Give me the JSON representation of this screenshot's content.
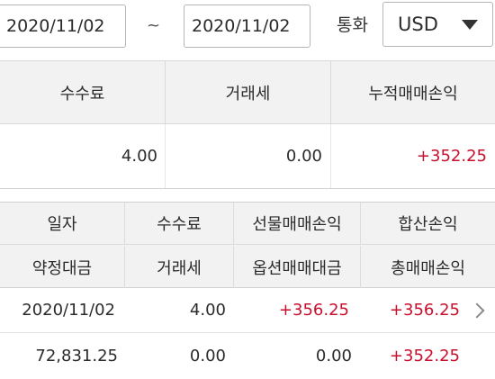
{
  "filter": {
    "date_from": "2020/11/02",
    "separator": "~",
    "date_to": "2020/11/02",
    "currency_label": "통화",
    "currency_value": "USD"
  },
  "summary": {
    "headers": [
      "수수료",
      "거래세",
      "누적매매손익"
    ],
    "values": [
      "4.00",
      "0.00",
      "+352.25"
    ]
  },
  "list": {
    "header_row1": [
      "일자",
      "수수료",
      "선물매매손익",
      "합산손익"
    ],
    "header_row2": [
      "약정대금",
      "거래세",
      "옵션매매대금",
      "총매매손익"
    ],
    "rows": [
      {
        "line1": [
          "2020/11/02",
          "4.00",
          "+356.25",
          "+356.25"
        ],
        "line2": [
          "72,831.25",
          "0.00",
          "0.00",
          "+352.25"
        ]
      }
    ]
  },
  "colors": {
    "positive": "#c8102e",
    "header_bg": "#f2f2f2",
    "border": "#d9d9d9"
  },
  "icons": {
    "currency_dropdown": "caret-down-icon",
    "row_detail": "chevron-right-icon"
  }
}
